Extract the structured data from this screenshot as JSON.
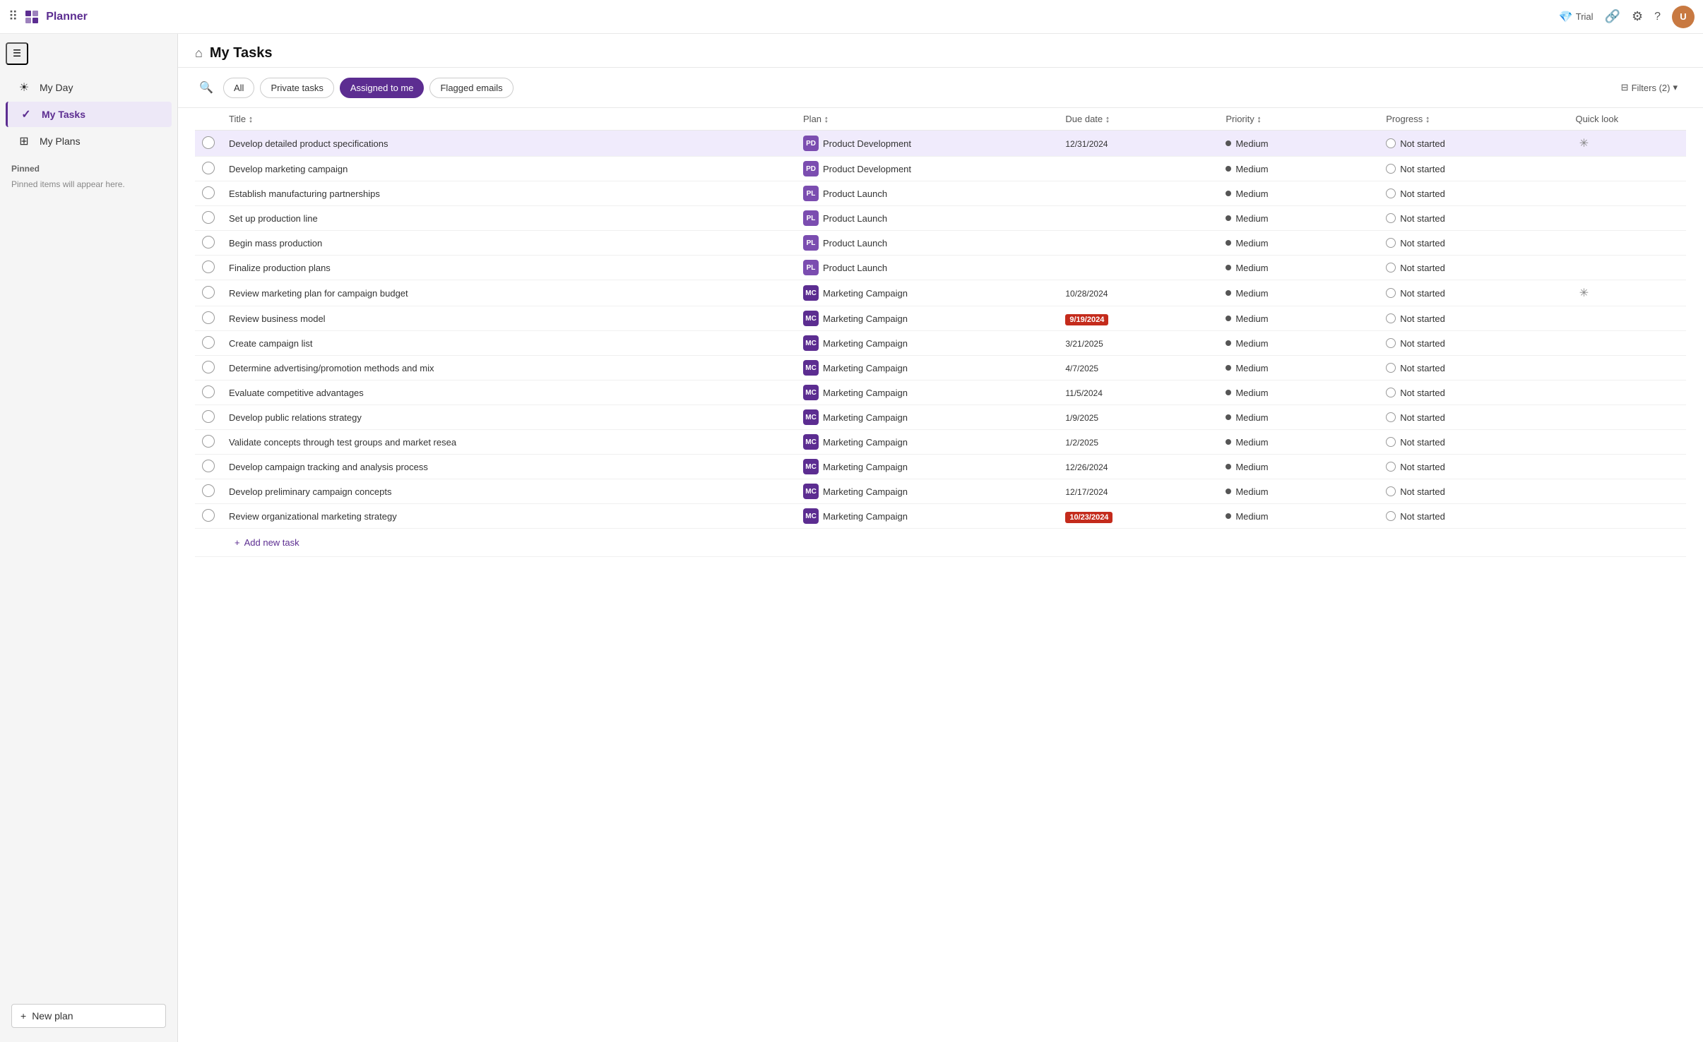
{
  "topbar": {
    "app_name": "Planner",
    "trial_label": "Trial",
    "settings_icon": "⚙",
    "help_icon": "?",
    "share_icon": "🔗",
    "waffle_icon": "⠿",
    "avatar_initials": "U"
  },
  "sidebar": {
    "collapse_icon": "☰",
    "nav_items": [
      {
        "id": "my-day",
        "label": "My Day",
        "icon": "☀",
        "active": false
      },
      {
        "id": "my-tasks",
        "label": "My Tasks",
        "icon": "✓",
        "active": true
      },
      {
        "id": "my-plans",
        "label": "My Plans",
        "icon": "⊞",
        "active": false
      }
    ],
    "pinned_section": "Pinned",
    "pinned_msg": "Pinned items will appear here.",
    "new_plan_label": "New plan",
    "new_plan_icon": "+"
  },
  "main": {
    "page_icon": "⌂",
    "page_title": "My Tasks",
    "filter_tabs": [
      {
        "id": "all",
        "label": "All",
        "active": false
      },
      {
        "id": "private-tasks",
        "label": "Private tasks",
        "active": false
      },
      {
        "id": "assigned-to-me",
        "label": "Assigned to me",
        "active": true
      },
      {
        "id": "flagged-emails",
        "label": "Flagged emails",
        "active": false
      }
    ],
    "filters_label": "Filters (2)",
    "filters_icon": "⊟",
    "table_headers": {
      "title": "Title",
      "plan": "Plan",
      "due_date": "Due date",
      "priority": "Priority",
      "progress": "Progress",
      "quick_look": "Quick look"
    },
    "tasks": [
      {
        "id": 1,
        "title": "Develop detailed product specifications",
        "plan_icon": "PD",
        "plan_icon_class": "plan-icon-pd",
        "plan": "Product Development",
        "due_date": "12/31/2024",
        "due_overdue": false,
        "priority": "Medium",
        "progress": "Not started",
        "has_quicklook": true,
        "selected": true
      },
      {
        "id": 2,
        "title": "Develop marketing campaign",
        "plan_icon": "PD",
        "plan_icon_class": "plan-icon-pd",
        "plan": "Product Development",
        "due_date": "",
        "due_overdue": false,
        "priority": "Medium",
        "progress": "Not started",
        "has_quicklook": false,
        "selected": false
      },
      {
        "id": 3,
        "title": "Establish manufacturing partnerships",
        "plan_icon": "PL",
        "plan_icon_class": "plan-icon-pl",
        "plan": "Product Launch",
        "due_date": "",
        "due_overdue": false,
        "priority": "Medium",
        "progress": "Not started",
        "has_quicklook": false,
        "selected": false
      },
      {
        "id": 4,
        "title": "Set up production line",
        "plan_icon": "PL",
        "plan_icon_class": "plan-icon-pl",
        "plan": "Product Launch",
        "due_date": "",
        "due_overdue": false,
        "priority": "Medium",
        "progress": "Not started",
        "has_quicklook": false,
        "selected": false
      },
      {
        "id": 5,
        "title": "Begin mass production",
        "plan_icon": "PL",
        "plan_icon_class": "plan-icon-pl",
        "plan": "Product Launch",
        "due_date": "",
        "due_overdue": false,
        "priority": "Medium",
        "progress": "Not started",
        "has_quicklook": false,
        "selected": false
      },
      {
        "id": 6,
        "title": "Finalize production plans",
        "plan_icon": "PL",
        "plan_icon_class": "plan-icon-pl",
        "plan": "Product Launch",
        "due_date": "",
        "due_overdue": false,
        "priority": "Medium",
        "progress": "Not started",
        "has_quicklook": false,
        "selected": false
      },
      {
        "id": 7,
        "title": "Review marketing plan for campaign budget",
        "plan_icon": "MC",
        "plan_icon_class": "plan-icon-mc",
        "plan": "Marketing Campaign",
        "due_date": "10/28/2024",
        "due_overdue": false,
        "priority": "Medium",
        "progress": "Not started",
        "has_quicklook": true,
        "selected": false
      },
      {
        "id": 8,
        "title": "Review business model",
        "plan_icon": "MC",
        "plan_icon_class": "plan-icon-mc",
        "plan": "Marketing Campaign",
        "due_date": "9/19/2024",
        "due_overdue": true,
        "priority": "Medium",
        "progress": "Not started",
        "has_quicklook": false,
        "selected": false
      },
      {
        "id": 9,
        "title": "Create campaign list",
        "plan_icon": "MC",
        "plan_icon_class": "plan-icon-mc",
        "plan": "Marketing Campaign",
        "due_date": "3/21/2025",
        "due_overdue": false,
        "priority": "Medium",
        "progress": "Not started",
        "has_quicklook": false,
        "selected": false
      },
      {
        "id": 10,
        "title": "Determine advertising/promotion methods and mix",
        "plan_icon": "MC",
        "plan_icon_class": "plan-icon-mc",
        "plan": "Marketing Campaign",
        "due_date": "4/7/2025",
        "due_overdue": false,
        "priority": "Medium",
        "progress": "Not started",
        "has_quicklook": false,
        "selected": false
      },
      {
        "id": 11,
        "title": "Evaluate competitive advantages",
        "plan_icon": "MC",
        "plan_icon_class": "plan-icon-mc",
        "plan": "Marketing Campaign",
        "due_date": "11/5/2024",
        "due_overdue": false,
        "priority": "Medium",
        "progress": "Not started",
        "has_quicklook": false,
        "selected": false
      },
      {
        "id": 12,
        "title": "Develop public relations strategy",
        "plan_icon": "MC",
        "plan_icon_class": "plan-icon-mc",
        "plan": "Marketing Campaign",
        "due_date": "1/9/2025",
        "due_overdue": false,
        "priority": "Medium",
        "progress": "Not started",
        "has_quicklook": false,
        "selected": false
      },
      {
        "id": 13,
        "title": "Validate concepts through test groups and market resea",
        "plan_icon": "MC",
        "plan_icon_class": "plan-icon-mc",
        "plan": "Marketing Campaign",
        "due_date": "1/2/2025",
        "due_overdue": false,
        "priority": "Medium",
        "progress": "Not started",
        "has_quicklook": false,
        "selected": false
      },
      {
        "id": 14,
        "title": "Develop campaign tracking and analysis process",
        "plan_icon": "MC",
        "plan_icon_class": "plan-icon-mc",
        "plan": "Marketing Campaign",
        "due_date": "12/26/2024",
        "due_overdue": false,
        "priority": "Medium",
        "progress": "Not started",
        "has_quicklook": false,
        "selected": false
      },
      {
        "id": 15,
        "title": "Develop preliminary campaign concepts",
        "plan_icon": "MC",
        "plan_icon_class": "plan-icon-mc",
        "plan": "Marketing Campaign",
        "due_date": "12/17/2024",
        "due_overdue": false,
        "priority": "Medium",
        "progress": "Not started",
        "has_quicklook": false,
        "selected": false
      },
      {
        "id": 16,
        "title": "Review organizational marketing strategy",
        "plan_icon": "MC",
        "plan_icon_class": "plan-icon-mc",
        "plan": "Marketing Campaign",
        "due_date": "10/23/2024",
        "due_overdue": true,
        "priority": "Medium",
        "progress": "Not started",
        "has_quicklook": false,
        "selected": false
      }
    ],
    "add_task_label": "Add new task"
  }
}
